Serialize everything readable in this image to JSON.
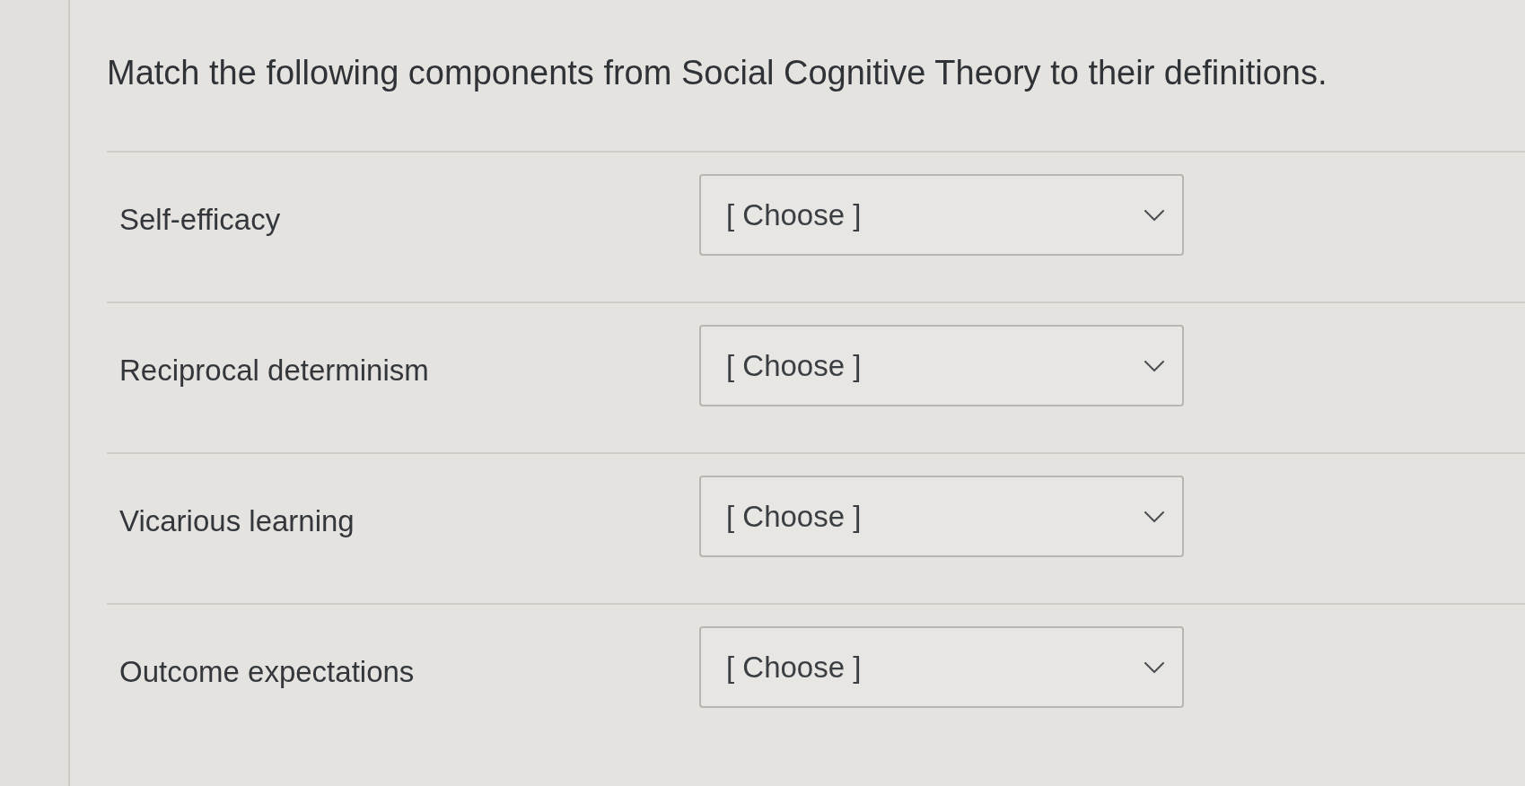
{
  "question": "Match the following components from Social Cognitive Theory to their definitions.",
  "rows": [
    {
      "term": "Self-efficacy",
      "dropdown": {
        "value": "[ Choose ]"
      }
    },
    {
      "term": "Reciprocal determinism",
      "dropdown": {
        "value": "[ Choose ]"
      }
    },
    {
      "term": "Vicarious learning",
      "dropdown": {
        "value": "[ Choose ]"
      }
    },
    {
      "term": "Outcome expectations",
      "dropdown": {
        "value": "[ Choose ]"
      }
    }
  ]
}
